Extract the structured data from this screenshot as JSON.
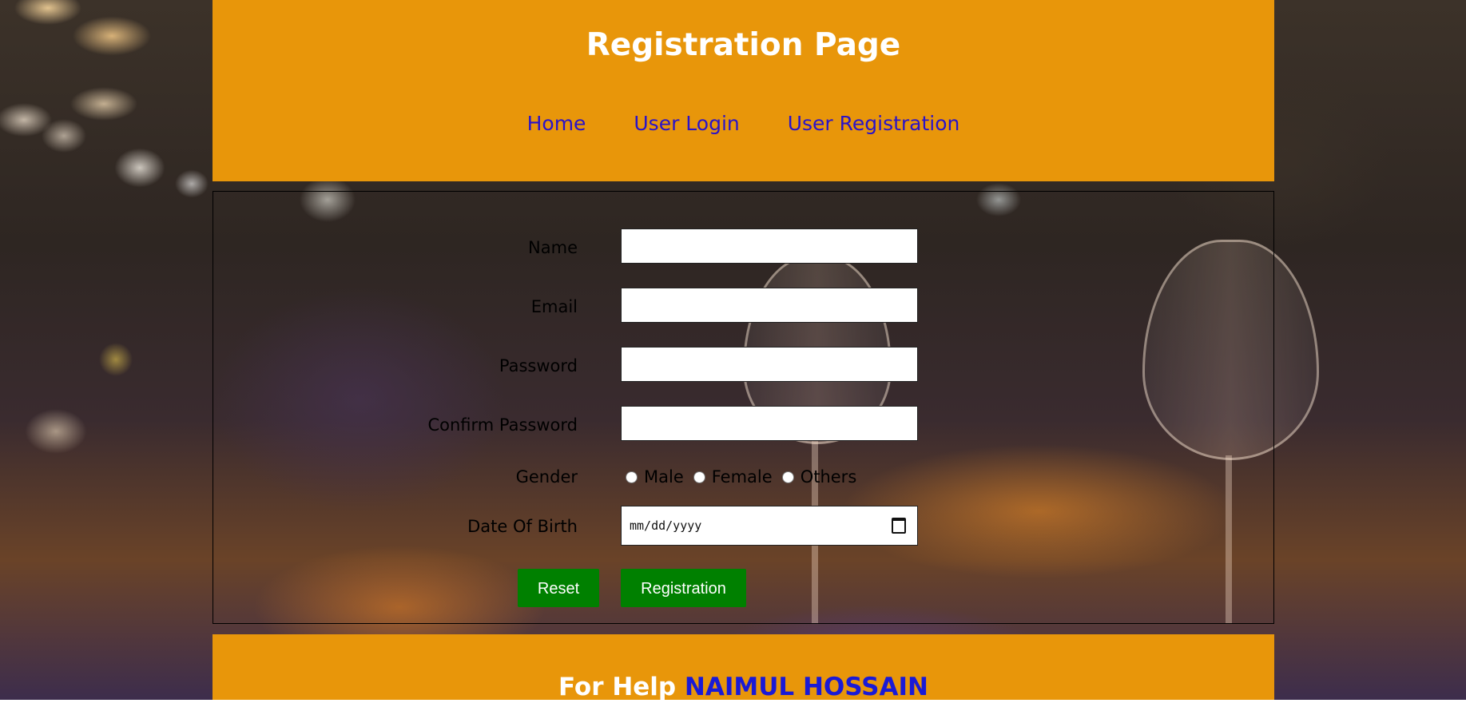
{
  "header": {
    "title": "Registration Page",
    "nav": [
      "Home",
      "User Login",
      "User Registration"
    ]
  },
  "form": {
    "name_label": "Name",
    "email_label": "Email",
    "password_label": "Password",
    "confirm_password_label": "Confirm Password",
    "gender_label": "Gender",
    "gender_options": [
      "Male",
      "Female",
      "Others"
    ],
    "dob_label": "Date Of Birth",
    "dob_placeholder": "mm/dd/yyyy",
    "reset_label": "Reset",
    "submit_label": "Registration"
  },
  "footer": {
    "help_text": "For Help",
    "name": "NAIMUL HOSSAIN"
  },
  "colors": {
    "header_bg": "#e8960a",
    "nav_link": "#2a13c8",
    "button_bg": "#008000",
    "footer_name": "#1a1ad6"
  }
}
